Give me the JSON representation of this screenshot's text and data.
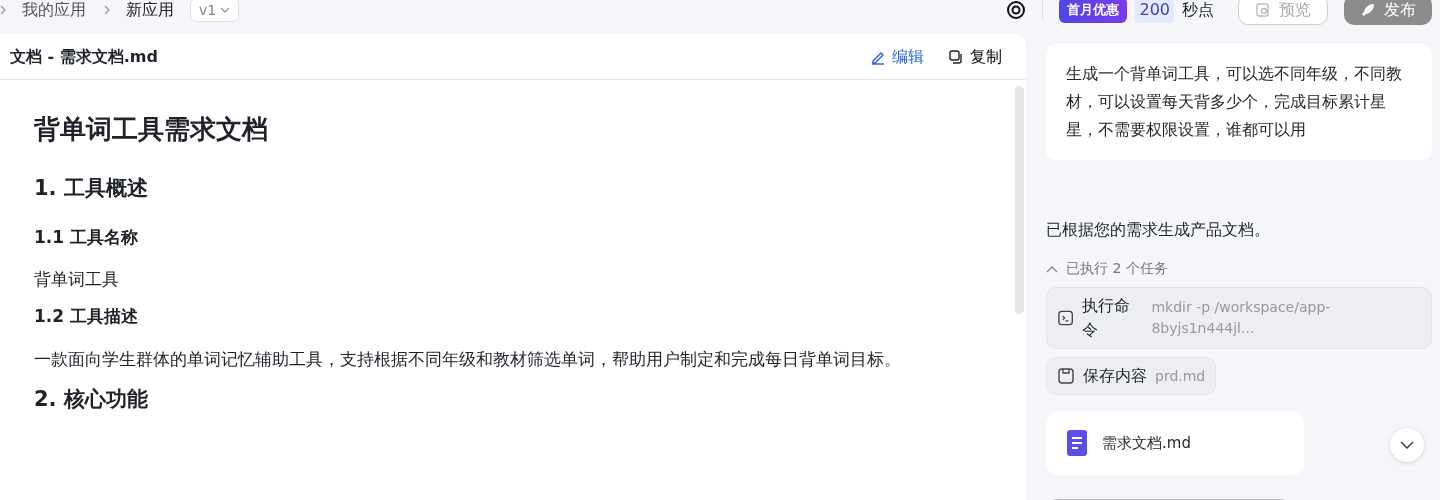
{
  "breadcrumb": {
    "items": [
      {
        "label": "我的应用"
      },
      {
        "label": "新应用"
      }
    ],
    "version": "v1"
  },
  "topbar": {
    "promo_badge": "首月优惠",
    "points": "200",
    "points_unit": "秒点",
    "buttons": [
      {
        "label": "预览",
        "kind": "outline",
        "disabled": true
      },
      {
        "label": "发布",
        "kind": "solid",
        "disabled": true
      }
    ]
  },
  "document": {
    "title": "文档 - 需求文档.md",
    "actions": [
      {
        "label": "编辑",
        "kind": "edit"
      },
      {
        "label": "复制",
        "kind": "copy"
      }
    ],
    "blocks": [
      {
        "kind": "h1",
        "text": "背单词工具需求文档"
      },
      {
        "kind": "h2",
        "text": "1. 工具概述"
      },
      {
        "kind": "h3",
        "text": "1.1 工具名称"
      },
      {
        "kind": "p",
        "text": "背单词工具"
      },
      {
        "kind": "h3",
        "text": "1.2 工具描述"
      },
      {
        "kind": "p",
        "text": "一款面向学生群体的单词记忆辅助工具，支持根据不同年级和教材筛选单词，帮助用户制定和完成每日背单词目标。"
      },
      {
        "kind": "h2",
        "text": "2. 核心功能"
      }
    ]
  },
  "chat": {
    "user_message": "生成一个背单词工具，可以选不同年级，不同教材，可以设置每天背多少个，完成目标累计星星，不需要权限设置，谁都可以用",
    "reply": "已根据您的需求生成产品文档。",
    "tasks": {
      "label": "已执行 2 个任务",
      "expanded": true,
      "items": [
        {
          "kind": "command",
          "label": "执行命令",
          "detail": "mkdir -p /workspace/app-8byjs1n444jl..."
        },
        {
          "kind": "save",
          "label": "保存内容",
          "detail": "prd.md"
        }
      ]
    },
    "file_card": {
      "name": "需求文档.md"
    }
  }
}
